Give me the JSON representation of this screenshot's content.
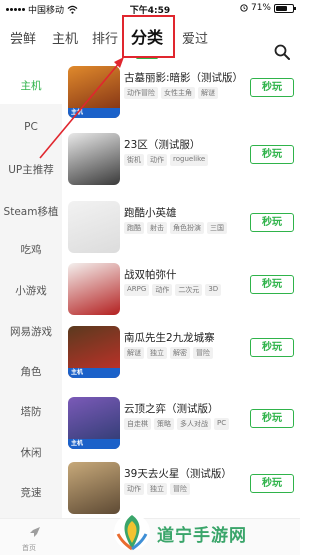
{
  "status_bar": {
    "carrier": "中国移动",
    "time": "下午4:59",
    "battery": "71%",
    "battery_level": 0.71
  },
  "top_tabs": [
    {
      "label": "尝鲜"
    },
    {
      "label": "主机"
    },
    {
      "label": "排行"
    },
    {
      "label": "分类",
      "active": true
    },
    {
      "label": "爱过"
    }
  ],
  "sidebar": {
    "items": [
      {
        "label": "主机",
        "active": true
      },
      {
        "label": "PC"
      },
      {
        "label": "UP主推荐"
      },
      {
        "label": "Steam移植"
      },
      {
        "label": "吃鸡"
      },
      {
        "label": "小游戏"
      },
      {
        "label": "网易游戏"
      },
      {
        "label": "角色"
      },
      {
        "label": "塔防"
      },
      {
        "label": "休闲"
      },
      {
        "label": "竞速"
      }
    ]
  },
  "games": [
    {
      "title": "古墓丽影:暗影（测试版）",
      "tags": [
        "动作冒险",
        "女性主角",
        "解谜"
      ],
      "badge": "主机",
      "play_label": "秒玩",
      "thumb_colors": [
        "#e08a2c",
        "#7a2a12"
      ]
    },
    {
      "title": "23区（测试服）",
      "tags": [
        "街机",
        "动作",
        "roguelike"
      ],
      "badge": "",
      "play_label": "秒玩",
      "thumb_colors": [
        "#e9e9e9",
        "#3a3a3a"
      ]
    },
    {
      "title": "跑酷小英雄",
      "tags": [
        "跑酷",
        "射击",
        "角色扮演",
        "三国"
      ],
      "badge": "",
      "play_label": "秒玩",
      "thumb_colors": [
        "#f2f2f2",
        "#dcdcdc"
      ]
    },
    {
      "title": "战双帕弥什",
      "tags": [
        "ARPG",
        "动作",
        "二次元",
        "3D"
      ],
      "badge": "",
      "play_label": "秒玩",
      "thumb_colors": [
        "#f4f0ee",
        "#b32020"
      ]
    },
    {
      "title": "南瓜先生2九龙城寨",
      "tags": [
        "解谜",
        "独立",
        "解密",
        "冒险"
      ],
      "badge": "主机",
      "play_label": "秒玩",
      "thumb_colors": [
        "#5a3a1e",
        "#c9302a"
      ]
    },
    {
      "title": "云顶之弈（测试版）",
      "tags": [
        "自走棋",
        "策略",
        "多人对战",
        "PC"
      ],
      "badge": "主机",
      "play_label": "秒玩",
      "thumb_colors": [
        "#7b5ab8",
        "#2a3a6e"
      ]
    },
    {
      "title": "39天去火星（测试版）",
      "tags": [
        "动作",
        "独立",
        "冒险"
      ],
      "badge": "",
      "play_label": "秒玩",
      "thumb_colors": [
        "#c7a97a",
        "#5e4a34"
      ]
    }
  ],
  "bottom_nav": {
    "home_label": "首页"
  },
  "watermark": {
    "text": "道宁手游网"
  },
  "colors": {
    "accent": "#2fb34a",
    "highlight": "#e0262e",
    "badge": "#1b61c9"
  }
}
